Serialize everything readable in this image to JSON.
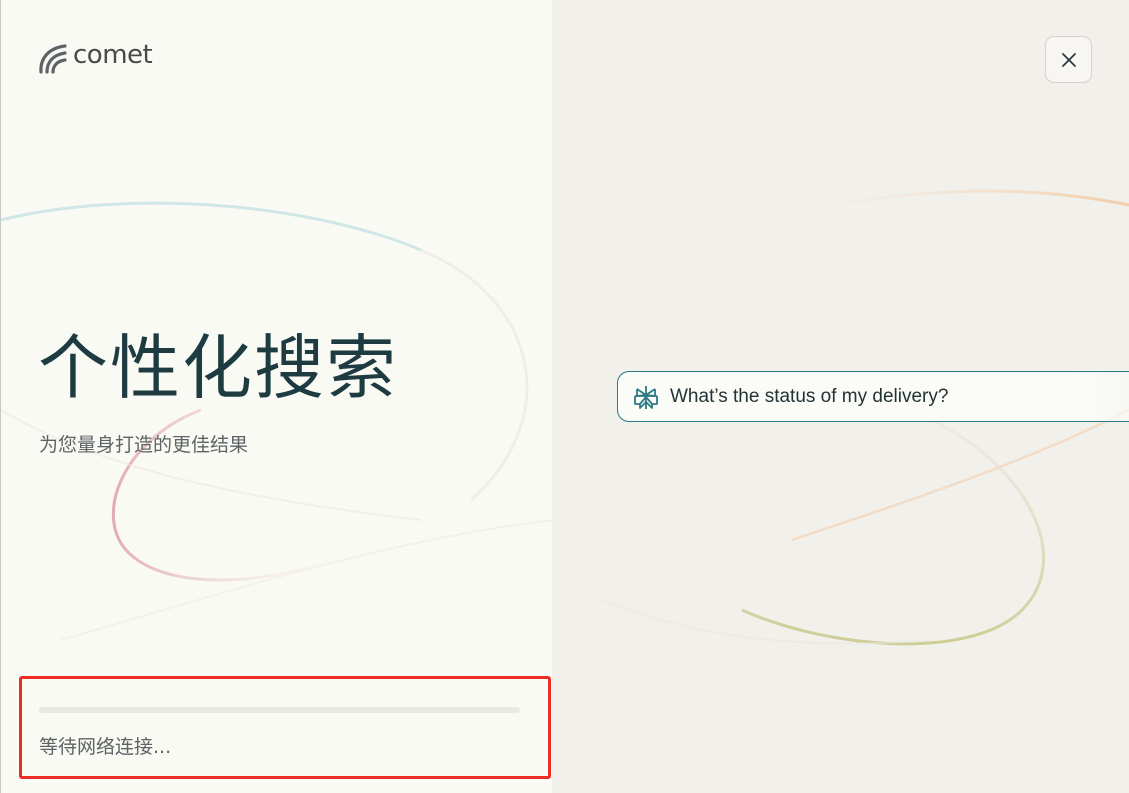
{
  "app": {
    "logo_text": "comet"
  },
  "hero": {
    "headline": "个性化搜索",
    "subtitle": "为您量身打造的更佳结果"
  },
  "status": {
    "text": "等待网络连接...",
    "progress": 0
  },
  "window": {
    "close_label": "×"
  },
  "preview": {
    "query_text": "What’s the status of my delivery?",
    "query_icon": "perplexity-icon"
  },
  "colors": {
    "accent": "#2c7a84",
    "headline": "#1d3b40",
    "highlight_box": "#ee2d27"
  }
}
